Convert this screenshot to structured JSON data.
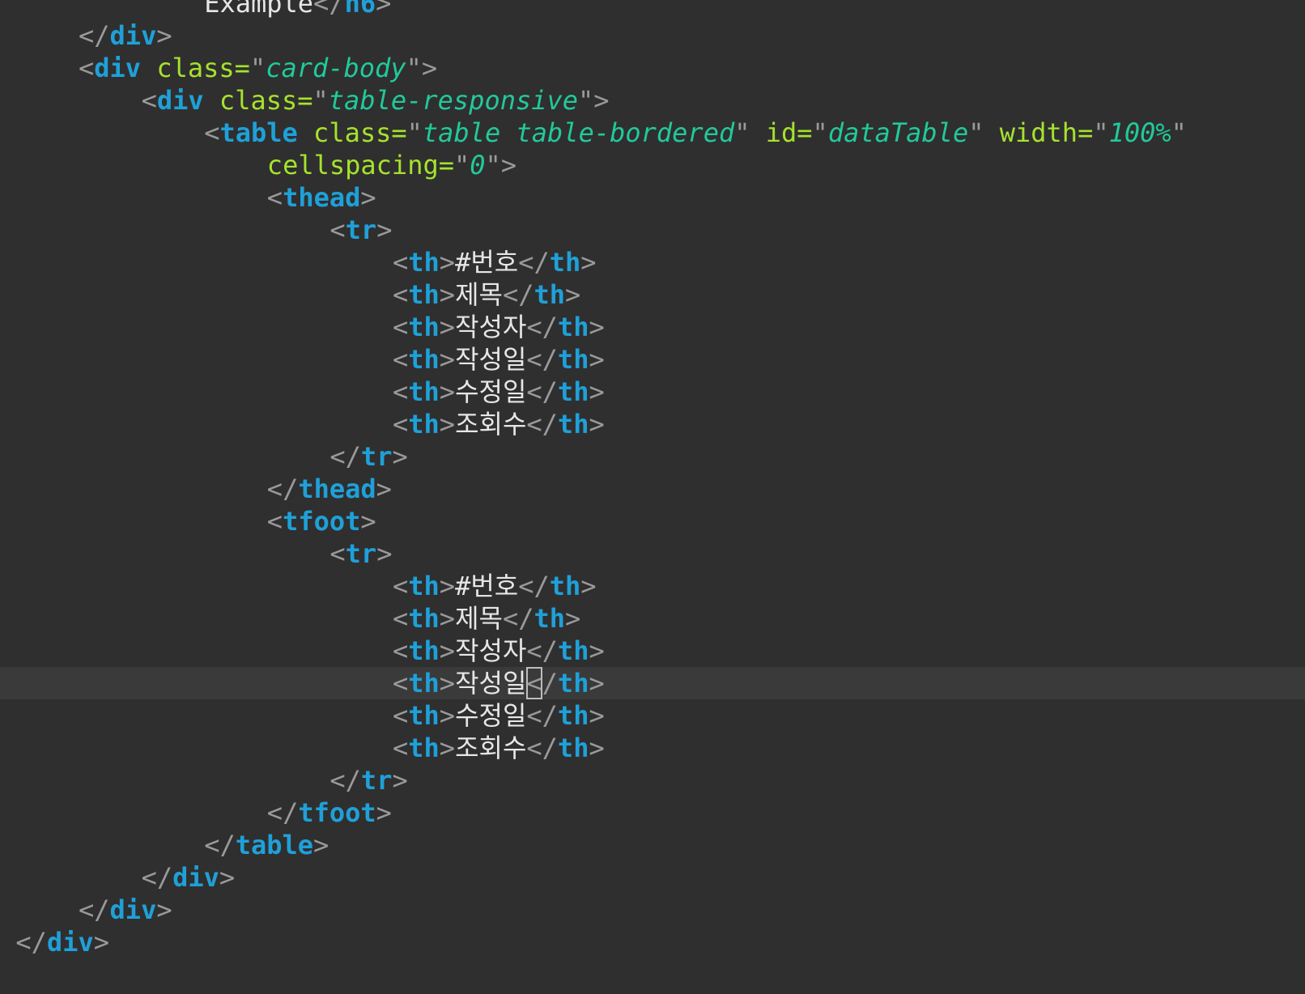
{
  "lines": [
    {
      "indent": 13,
      "tokens": [
        [
          "text",
          "Example"
        ],
        [
          "punct",
          "</"
        ],
        [
          "tag",
          "h6"
        ],
        [
          "punct",
          ">"
        ]
      ]
    },
    {
      "indent": 5,
      "tokens": [
        [
          "punct",
          "</"
        ],
        [
          "tag",
          "div"
        ],
        [
          "punct",
          ">"
        ]
      ]
    },
    {
      "indent": 5,
      "tokens": [
        [
          "punct",
          "<"
        ],
        [
          "tag",
          "div"
        ],
        [
          "punct",
          " "
        ],
        [
          "attr",
          "class"
        ],
        [
          "attr",
          "="
        ],
        [
          "punct",
          "\""
        ],
        [
          "str",
          "card-body"
        ],
        [
          "punct",
          "\""
        ],
        [
          "punct",
          ">"
        ]
      ]
    },
    {
      "indent": 9,
      "tokens": [
        [
          "punct",
          "<"
        ],
        [
          "tag",
          "div"
        ],
        [
          "punct",
          " "
        ],
        [
          "attr",
          "class"
        ],
        [
          "attr",
          "="
        ],
        [
          "punct",
          "\""
        ],
        [
          "str",
          "table-responsive"
        ],
        [
          "punct",
          "\""
        ],
        [
          "punct",
          ">"
        ]
      ]
    },
    {
      "indent": 13,
      "tokens": [
        [
          "punct",
          "<"
        ],
        [
          "tag",
          "table"
        ],
        [
          "punct",
          " "
        ],
        [
          "attr",
          "class"
        ],
        [
          "attr",
          "="
        ],
        [
          "punct",
          "\""
        ],
        [
          "str",
          "table table-bordered"
        ],
        [
          "punct",
          "\""
        ],
        [
          "punct",
          " "
        ],
        [
          "attr",
          "id"
        ],
        [
          "attr",
          "="
        ],
        [
          "punct",
          "\""
        ],
        [
          "str",
          "dataTable"
        ],
        [
          "punct",
          "\""
        ],
        [
          "punct",
          " "
        ],
        [
          "attr",
          "width"
        ],
        [
          "attr",
          "="
        ],
        [
          "punct",
          "\""
        ],
        [
          "str",
          "100%"
        ],
        [
          "punct",
          "\""
        ]
      ]
    },
    {
      "indent": 17,
      "tokens": [
        [
          "attr",
          "cellspacing"
        ],
        [
          "attr",
          "="
        ],
        [
          "punct",
          "\""
        ],
        [
          "str",
          "0"
        ],
        [
          "punct",
          "\""
        ],
        [
          "punct",
          ">"
        ]
      ]
    },
    {
      "indent": 17,
      "tokens": [
        [
          "punct",
          "<"
        ],
        [
          "tag",
          "thead"
        ],
        [
          "punct",
          ">"
        ]
      ]
    },
    {
      "indent": 21,
      "tokens": [
        [
          "punct",
          "<"
        ],
        [
          "tag",
          "tr"
        ],
        [
          "punct",
          ">"
        ]
      ]
    },
    {
      "indent": 25,
      "tokens": [
        [
          "punct",
          "<"
        ],
        [
          "tag",
          "th"
        ],
        [
          "punct",
          ">"
        ],
        [
          "text",
          "#번호"
        ],
        [
          "punct",
          "</"
        ],
        [
          "tag",
          "th"
        ],
        [
          "punct",
          ">"
        ]
      ]
    },
    {
      "indent": 25,
      "tokens": [
        [
          "punct",
          "<"
        ],
        [
          "tag",
          "th"
        ],
        [
          "punct",
          ">"
        ],
        [
          "text",
          "제목"
        ],
        [
          "punct",
          "</"
        ],
        [
          "tag",
          "th"
        ],
        [
          "punct",
          ">"
        ]
      ]
    },
    {
      "indent": 25,
      "tokens": [
        [
          "punct",
          "<"
        ],
        [
          "tag",
          "th"
        ],
        [
          "punct",
          ">"
        ],
        [
          "text",
          "작성자"
        ],
        [
          "punct",
          "</"
        ],
        [
          "tag",
          "th"
        ],
        [
          "punct",
          ">"
        ]
      ]
    },
    {
      "indent": 25,
      "tokens": [
        [
          "punct",
          "<"
        ],
        [
          "tag",
          "th"
        ],
        [
          "punct",
          ">"
        ],
        [
          "text",
          "작성일"
        ],
        [
          "punct",
          "</"
        ],
        [
          "tag",
          "th"
        ],
        [
          "punct",
          ">"
        ]
      ]
    },
    {
      "indent": 25,
      "tokens": [
        [
          "punct",
          "<"
        ],
        [
          "tag",
          "th"
        ],
        [
          "punct",
          ">"
        ],
        [
          "text",
          "수정일"
        ],
        [
          "punct",
          "</"
        ],
        [
          "tag",
          "th"
        ],
        [
          "punct",
          ">"
        ]
      ]
    },
    {
      "indent": 25,
      "tokens": [
        [
          "punct",
          "<"
        ],
        [
          "tag",
          "th"
        ],
        [
          "punct",
          ">"
        ],
        [
          "text",
          "조회수"
        ],
        [
          "punct",
          "</"
        ],
        [
          "tag",
          "th"
        ],
        [
          "punct",
          ">"
        ]
      ]
    },
    {
      "indent": 21,
      "tokens": [
        [
          "punct",
          "</"
        ],
        [
          "tag",
          "tr"
        ],
        [
          "punct",
          ">"
        ]
      ]
    },
    {
      "indent": 17,
      "tokens": [
        [
          "punct",
          "</"
        ],
        [
          "tag",
          "thead"
        ],
        [
          "punct",
          ">"
        ]
      ]
    },
    {
      "indent": 17,
      "tokens": [
        [
          "punct",
          "<"
        ],
        [
          "tag",
          "tfoot"
        ],
        [
          "punct",
          ">"
        ]
      ]
    },
    {
      "indent": 21,
      "tokens": [
        [
          "punct",
          "<"
        ],
        [
          "tag",
          "tr"
        ],
        [
          "punct",
          ">"
        ]
      ]
    },
    {
      "indent": 25,
      "tokens": [
        [
          "punct",
          "<"
        ],
        [
          "tag",
          "th"
        ],
        [
          "punct",
          ">"
        ],
        [
          "text",
          "#번호"
        ],
        [
          "punct",
          "</"
        ],
        [
          "tag",
          "th"
        ],
        [
          "punct",
          ">"
        ]
      ]
    },
    {
      "indent": 25,
      "tokens": [
        [
          "punct",
          "<"
        ],
        [
          "tag",
          "th"
        ],
        [
          "punct",
          ">"
        ],
        [
          "text",
          "제목"
        ],
        [
          "punct",
          "</"
        ],
        [
          "tag",
          "th"
        ],
        [
          "punct",
          ">"
        ]
      ]
    },
    {
      "indent": 25,
      "tokens": [
        [
          "punct",
          "<"
        ],
        [
          "tag",
          "th"
        ],
        [
          "punct",
          ">"
        ],
        [
          "text",
          "작성자"
        ],
        [
          "punct",
          "</"
        ],
        [
          "tag",
          "th"
        ],
        [
          "punct",
          ">"
        ]
      ]
    },
    {
      "indent": 25,
      "current": true,
      "tokens": [
        [
          "punct",
          "<"
        ],
        [
          "tag",
          "th"
        ],
        [
          "punct",
          ">"
        ],
        [
          "text",
          "작성일"
        ],
        [
          "punct",
          "<",
          "caret"
        ],
        [
          "punct",
          "/"
        ],
        [
          "tag",
          "th"
        ],
        [
          "punct",
          ">"
        ]
      ]
    },
    {
      "indent": 25,
      "tokens": [
        [
          "punct",
          "<"
        ],
        [
          "tag",
          "th"
        ],
        [
          "punct",
          ">"
        ],
        [
          "text",
          "수정일"
        ],
        [
          "punct",
          "</"
        ],
        [
          "tag",
          "th"
        ],
        [
          "punct",
          ">"
        ]
      ]
    },
    {
      "indent": 25,
      "tokens": [
        [
          "punct",
          "<"
        ],
        [
          "tag",
          "th"
        ],
        [
          "punct",
          ">"
        ],
        [
          "text",
          "조회수"
        ],
        [
          "punct",
          "</"
        ],
        [
          "tag",
          "th"
        ],
        [
          "punct",
          ">"
        ]
      ]
    },
    {
      "indent": 21,
      "tokens": [
        [
          "punct",
          "</"
        ],
        [
          "tag",
          "tr"
        ],
        [
          "punct",
          ">"
        ]
      ]
    },
    {
      "indent": 17,
      "tokens": [
        [
          "punct",
          "</"
        ],
        [
          "tag",
          "tfoot"
        ],
        [
          "punct",
          ">"
        ]
      ]
    },
    {
      "indent": 13,
      "tokens": [
        [
          "punct",
          "</"
        ],
        [
          "tag",
          "table"
        ],
        [
          "punct",
          ">"
        ]
      ]
    },
    {
      "indent": 9,
      "tokens": [
        [
          "punct",
          "</"
        ],
        [
          "tag",
          "div"
        ],
        [
          "punct",
          ">"
        ]
      ]
    },
    {
      "indent": 5,
      "tokens": [
        [
          "punct",
          "</"
        ],
        [
          "tag",
          "div"
        ],
        [
          "punct",
          ">"
        ]
      ]
    },
    {
      "indent": 1,
      "tokens": [
        [
          "punct",
          "</"
        ],
        [
          "tag",
          "div"
        ],
        [
          "punct",
          ">"
        ]
      ]
    },
    {
      "indent": 0,
      "tokens": []
    },
    {
      "indent": 0,
      "tokens": [
        [
          "tag",
          ".."
        ]
      ]
    }
  ]
}
